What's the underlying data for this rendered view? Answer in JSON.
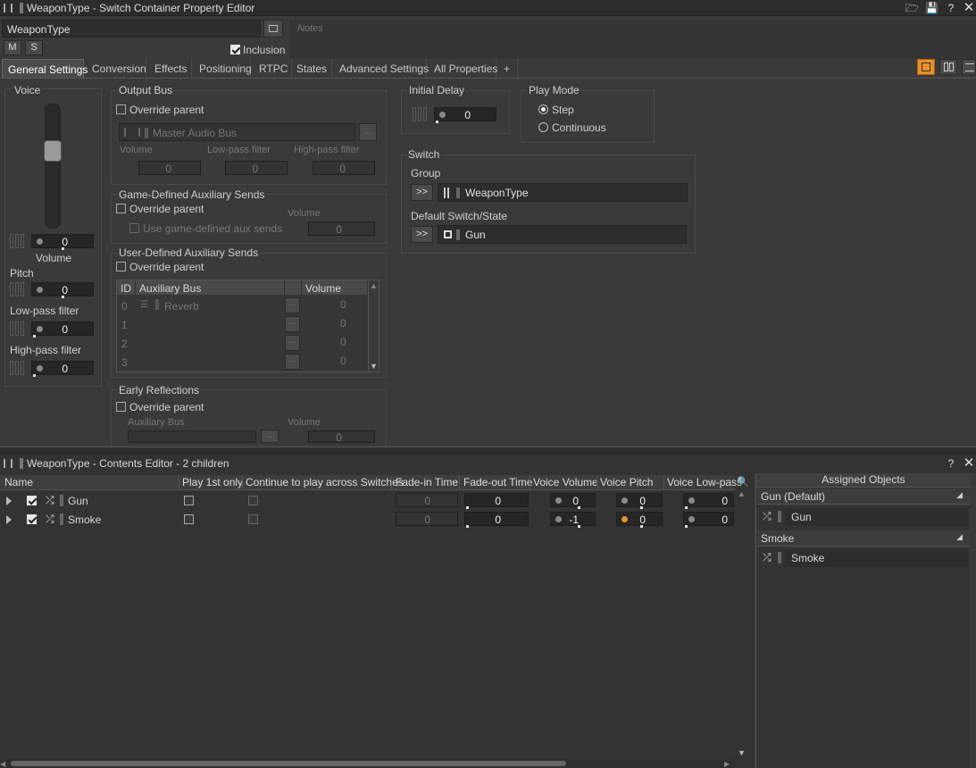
{
  "window": {
    "title": "WeaponType - Switch Container Property Editor"
  },
  "header": {
    "name_value": "WeaponType",
    "m_label": "M",
    "s_label": "S",
    "inclusion_label": "Inclusion",
    "notes_placeholder": "Notes"
  },
  "tabs": [
    "General Settings",
    "Conversion",
    "Effects",
    "Positioning",
    "RTPC",
    "States",
    "Advanced Settings",
    "All Properties",
    "+"
  ],
  "voice": {
    "title": "Voice",
    "volume_value": "0",
    "volume_label": "Volume",
    "pitch_label": "Pitch",
    "pitch_value": "0",
    "lowpass_label": "Low-pass filter",
    "lowpass_value": "0",
    "highpass_label": "High-pass filter",
    "highpass_value": "0"
  },
  "output_bus": {
    "title": "Output Bus",
    "override_label": "Override parent",
    "bus_name": "Master Audio Bus",
    "browse_label": "...",
    "volume_label": "Volume",
    "volume_value": "0",
    "lowpass_label": "Low-pass filter",
    "lowpass_value": "0",
    "highpass_label": "High-pass filter",
    "highpass_value": "0"
  },
  "game_aux": {
    "title": "Game-Defined Auxiliary Sends",
    "override_label": "Override parent",
    "use_label": "Use game-defined aux sends",
    "volume_label": "Volume",
    "volume_value": "0"
  },
  "user_aux": {
    "title": "User-Defined Auxiliary Sends",
    "override_label": "Override parent",
    "col_id": "ID",
    "col_bus": "Auxiliary Bus",
    "col_volume": "Volume",
    "rows": [
      {
        "id": "0",
        "bus": "Reverb",
        "browse": "...",
        "volume": "0"
      },
      {
        "id": "1",
        "bus": "",
        "browse": "...",
        "volume": "0"
      },
      {
        "id": "2",
        "bus": "",
        "browse": "...",
        "volume": "0"
      },
      {
        "id": "3",
        "bus": "",
        "browse": "...",
        "volume": "0"
      }
    ]
  },
  "early_reflections": {
    "title": "Early Reflections",
    "override_label": "Override parent",
    "aux_label": "Auxiliary Bus",
    "browse_label": "...",
    "volume_label": "Volume",
    "volume_value": "0"
  },
  "initial_delay": {
    "title": "Initial Delay",
    "value": "0"
  },
  "play_mode": {
    "title": "Play Mode",
    "step_label": "Step",
    "continuous_label": "Continuous",
    "selected": "Step"
  },
  "switch": {
    "title": "Switch",
    "group_label": "Group",
    "group_button": ">>",
    "group_value": "WeaponType",
    "default_label": "Default Switch/State",
    "default_button": ">>",
    "default_value": "Gun"
  },
  "contents": {
    "title": "WeaponType - Contents Editor - 2 children",
    "columns": [
      "Name",
      "Play 1st only",
      "Continue to play across Switches",
      "Fade-in Time",
      "Fade-out Time",
      "Voice Volume",
      "Voice Pitch",
      "Voice Low-pass"
    ],
    "rows": [
      {
        "name": "Gun",
        "fade_in": "0",
        "fade_out": "0",
        "volume": "0",
        "pitch": "0",
        "lowpass": "0"
      },
      {
        "name": "Smoke",
        "fade_in": "0",
        "fade_out": "0",
        "volume": "-1",
        "pitch": "0",
        "lowpass": "0"
      }
    ]
  },
  "assigned": {
    "title": "Assigned Objects",
    "groups": [
      {
        "label": "Gun (Default)",
        "item": "Gun"
      },
      {
        "label": "Smoke",
        "item": "Smoke"
      }
    ]
  },
  "colors": {
    "accent_orange": "#e8902a",
    "background": "#3a3a3a"
  }
}
